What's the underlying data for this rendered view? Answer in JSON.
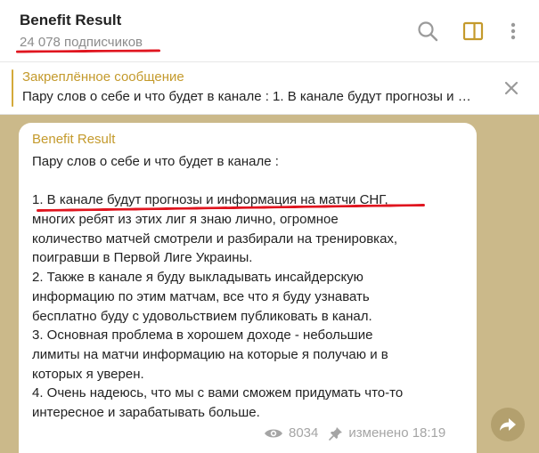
{
  "header": {
    "title": "Benefit Result",
    "subscribers": "24 078 подписчиков"
  },
  "pinned": {
    "title": "Закреплённое сообщение",
    "text": "Пару слов о себе и что будет в канале :    1. В канале будут прогнозы и информация на матчи СНГ, многих ребят"
  },
  "message": {
    "author": "Benefit Result",
    "lines": [
      "Пару слов о себе и что будет в канале :",
      "",
      "1. В канале будут прогнозы и информация на матчи СНГ,",
      "многих ребят из этих лиг я знаю лично, огромное",
      "количество матчей смотрели и разбирали на тренировках,",
      "поигравши в Первой Лиге Украины.",
      "2. Также в канале я буду выкладывать инсайдерскую",
      "информацию по этим матчам, все что я буду узнавать",
      "бесплатно буду с удовольствием публиковать в канал.",
      "3. Основная проблема в хорошем доходе - небольшие",
      "лимиты на матчи информацию на которые я получаю и в",
      "которых я уверен.",
      "4. Очень надеюсь, что мы с вами сможем придумать что-то",
      "интересное и зарабатывать больше."
    ],
    "views": "8034",
    "edited": "изменено 18:19"
  },
  "colors": {
    "accent": "#c49a2c",
    "annotation": "#e0151f",
    "background": "#cbb98a"
  },
  "icons": {
    "search": "search-icon",
    "sidebar": "sidebar-toggle-icon",
    "more": "more-vertical-icon",
    "close": "close-icon",
    "eye": "eye-icon",
    "pin": "pin-icon",
    "share": "share-icon"
  }
}
